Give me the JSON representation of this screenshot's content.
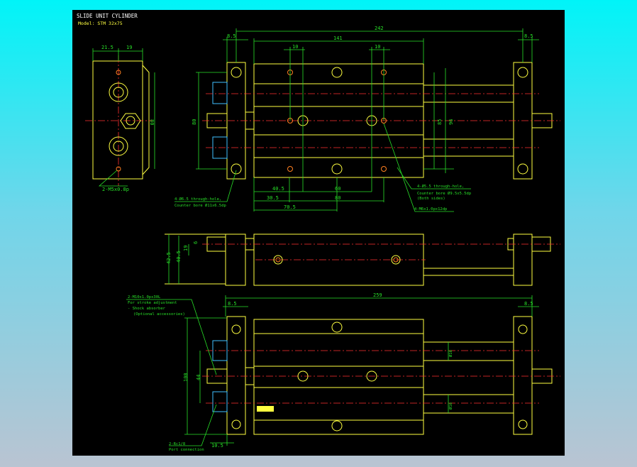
{
  "title": "SLIDE UNIT CYLINDER",
  "model": "Model: STM 32x75",
  "colors": {
    "background_top": "#00f4f8",
    "background_bottom": "#b9c4d2",
    "canvas": "#000000",
    "outline": "#ffff40",
    "dimension": "#28e028",
    "centerline": "#ff3030"
  },
  "end_view": {
    "dims": [
      "21.5",
      "19",
      "80"
    ],
    "note": "2-M5x0.8p"
  },
  "top_view": {
    "dims": {
      "overall": "242",
      "body": "141",
      "left_plate": "8.5",
      "right_plate": "8.5",
      "pitch_left": "10",
      "pitch_right": "10",
      "height_left": "80",
      "height_85": "85",
      "height_96": "96",
      "d40_5": "40.5",
      "d60": "60",
      "d30_5": "30.5",
      "d80": "80",
      "d70_5": "70.5"
    },
    "note_left": [
      "4-Ø6.5 through-hole,",
      "Counter bore Ø11x6.5dp"
    ],
    "note_right": [
      "4-Ø5.5 through-hole,",
      "Counter bore Ø9.5x5.5dp",
      "(Both sides)"
    ],
    "note_tap": "4-M6x1.0px12dp"
  },
  "side_view": {
    "dims": [
      "42.5",
      "40.5",
      "19",
      "6"
    ]
  },
  "bottom_view": {
    "dims": {
      "overall": "259",
      "left_plate": "8.5",
      "right_plate": "8.5",
      "height": "100",
      "inner": "44",
      "rod_top": "Ø16",
      "rod_bottom": "Ø16",
      "bottom_offset": "10.5"
    },
    "note_adjust": [
      "2-M10x1.0px30L",
      "For stroke adjustment",
      "- Shock absorber",
      "(Optional accessories)"
    ],
    "note_port": [
      "2-Rc1/8",
      "Port connection"
    ]
  }
}
